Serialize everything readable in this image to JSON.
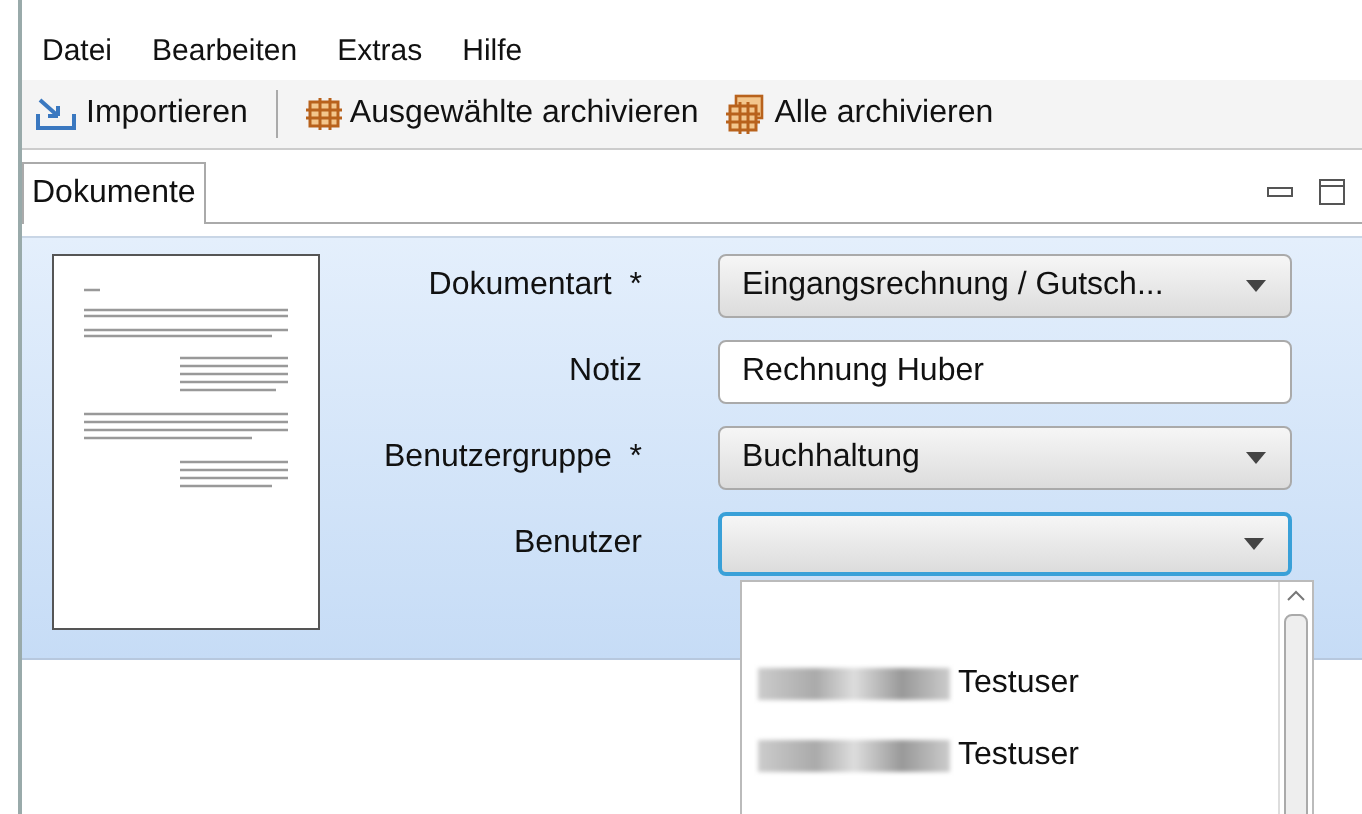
{
  "menu": [
    {
      "label": "Datei"
    },
    {
      "label": "Bearbeiten"
    },
    {
      "label": "Extras"
    },
    {
      "label": "Hilfe"
    }
  ],
  "toolbar": [
    {
      "label": "Importieren",
      "kind": "import"
    },
    {
      "label": "Ausgewählte archivieren",
      "kind": "archive"
    },
    {
      "label": "Alle archivieren",
      "kind": "archive-all"
    }
  ],
  "tabs": [
    {
      "label": "Dokumente",
      "selected": true
    }
  ],
  "form": {
    "fields": [
      {
        "label": "Dokumentart",
        "marker": "*",
        "kind": "combo",
        "value": "Eingangsrechnung / Gutsch...",
        "focused": false
      },
      {
        "label": "Notiz",
        "kind": "text",
        "value": "Rechnung Huber",
        "focused": false
      },
      {
        "label": "Benutzergruppe",
        "marker": "*",
        "kind": "combo",
        "value": "Buchhaltung",
        "focused": false
      },
      {
        "label": "Benutzer",
        "kind": "combo",
        "focused": true
      }
    ]
  },
  "dropdown": {
    "items": [
      {
        "label": "Testuser",
        "redacted": true
      },
      {
        "label": "Testuser",
        "redacted": true
      }
    ]
  }
}
